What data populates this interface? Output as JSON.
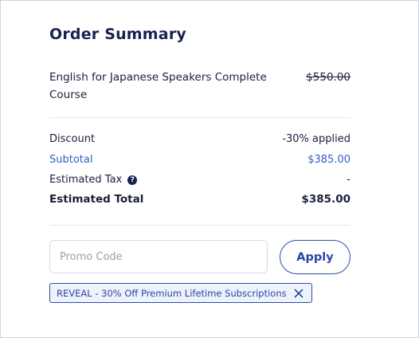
{
  "summary": {
    "title": "Order Summary"
  },
  "item": {
    "name": "English for Japanese Speakers Complete Course",
    "price": "$550.00"
  },
  "lines": {
    "discount_label": "Discount",
    "discount_value": "-30% applied",
    "subtotal_label": "Subtotal",
    "subtotal_value": "$385.00",
    "tax_label": "Estimated Tax",
    "tax_help_icon": "question-circle-icon",
    "tax_help_glyph": "?",
    "tax_value": "-",
    "total_label": "Estimated Total",
    "total_value": "$385.00"
  },
  "promo": {
    "placeholder": "Promo Code",
    "value": "",
    "apply_label": "Apply",
    "applied_code": "REVEAL - 30% Off Premium Lifetime Subscriptions",
    "remove_icon": "close-icon"
  },
  "colors": {
    "accent": "#2a47a6",
    "title": "#1a2150",
    "link": "#2f5fc6"
  }
}
